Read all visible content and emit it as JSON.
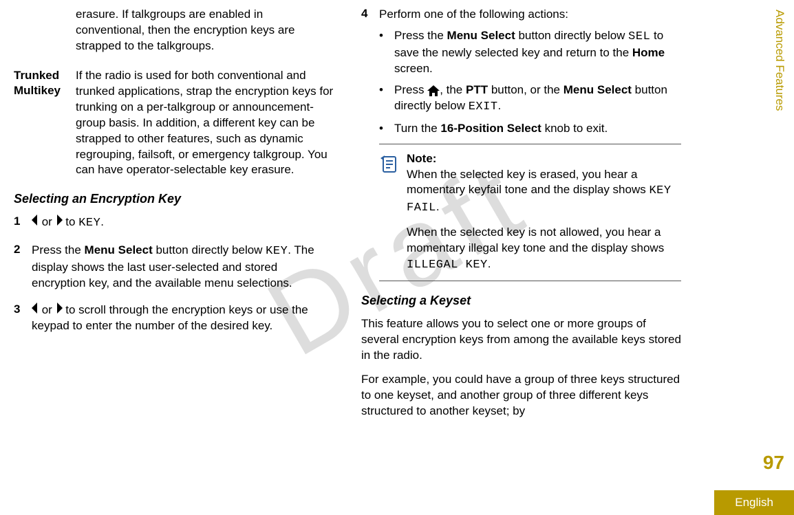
{
  "watermark": "Draft",
  "leftColumn": {
    "def0": {
      "text": "erasure. If talkgroups are enabled in conventional, then the encryption keys are strapped to the talkgroups."
    },
    "def1": {
      "term": "Trunked Multikey",
      "text": "If the radio is used for both conventional and trunked applications, strap the encryption keys for trunking on a per-talkgroup or announcement-group basis. In addition, a different key can be strapped to other features, such as dynamic regrouping, failsoft, or emergency talkgroup. You can have operator-selectable key erasure."
    },
    "heading1": "Selecting an Encryption Key",
    "step1": {
      "num": "1",
      "pre": "",
      "or": " or ",
      "to": " to ",
      "key": "KEY",
      "end": "."
    },
    "step2": {
      "num": "2",
      "a": "Press the ",
      "b": "Menu Select",
      "c": " button directly below ",
      "key": "KEY",
      "d": ". The display shows the last user-selected and stored encryption key, and the available menu selections."
    },
    "step3": {
      "num": "3",
      "or": " or ",
      "text": " to scroll through the encryption keys or use the keypad to enter the number of the desired key."
    }
  },
  "rightColumn": {
    "step4": {
      "num": "4",
      "intro": "Perform one of the following actions:",
      "b1": {
        "a": "Press the ",
        "b": "Menu Select",
        "c": " button directly below ",
        "sel": "SEL",
        "d": " to save the newly selected key and return to the ",
        "home": "Home",
        "e": " screen."
      },
      "b2": {
        "a": "Press ",
        "b": ", the ",
        "ptt": "PTT",
        "c": " button, or the ",
        "ms": "Menu Select",
        "d": " button directly below ",
        "exit": "EXIT",
        "e": "."
      },
      "b3": {
        "a": "Turn the ",
        "knob": "16-Position Select",
        "b": " knob to exit."
      }
    },
    "note": {
      "title": "Note:",
      "p1a": "When the selected key is erased, you hear a momentary keyfail tone and the display shows ",
      "p1b": "KEY FAIL",
      "p1c": ".",
      "p2a": "When the selected key is not allowed, you hear a momentary illegal key tone and the display shows ",
      "p2b": "ILLEGAL KEY",
      "p2c": "."
    },
    "heading2": "Selecting a Keyset",
    "para1": "This feature allows you to select one or more groups of several encryption keys from among the available keys stored in the radio.",
    "para2": "For example, you could have a group of three keys structured to one keyset, and another group of three different keys structured to another keyset; by"
  },
  "sideTab": "Advanced Features",
  "pageNum": "97",
  "language": "English"
}
